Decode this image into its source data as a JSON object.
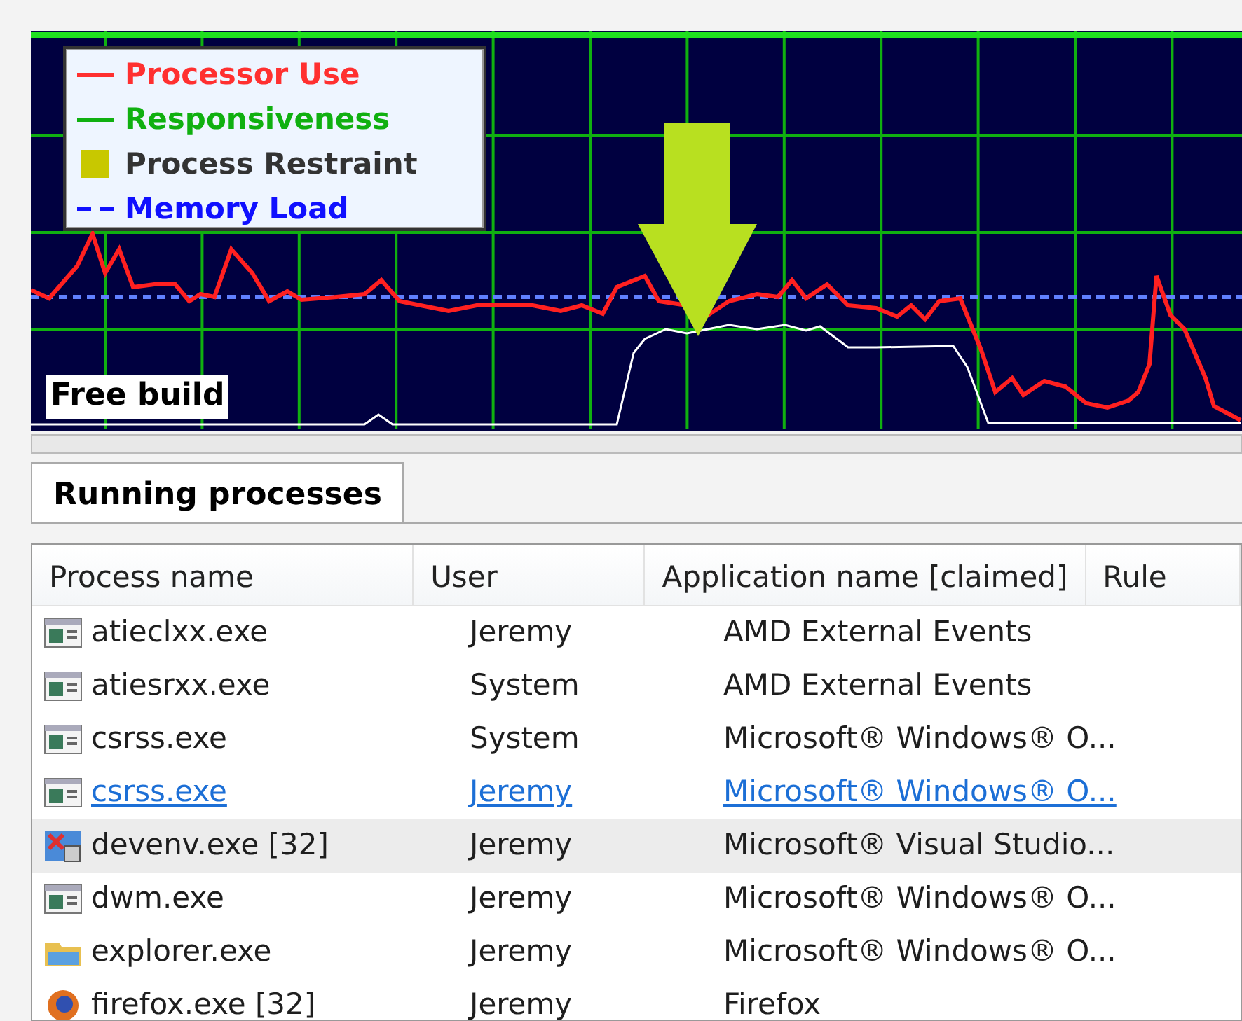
{
  "graph": {
    "legend": [
      {
        "label": "Processor Use",
        "kind": "line",
        "color": "#ff3030"
      },
      {
        "label": "Responsiveness",
        "kind": "line",
        "color": "#10b010"
      },
      {
        "label": "Process Restraint",
        "kind": "square",
        "color": "#c8c800"
      },
      {
        "label": "Memory Load",
        "kind": "dashed",
        "color": "#1010ff"
      }
    ],
    "build_label": "Free build"
  },
  "tabs": [
    {
      "label": "Running processes",
      "selected": true
    }
  ],
  "table": {
    "columns": [
      "Process name",
      "User",
      "Application name [claimed]",
      "Rule"
    ],
    "rows": [
      {
        "kind": "window",
        "cells": [
          "atieclxx.exe",
          "Jeremy",
          "AMD External Events"
        ],
        "hot": false,
        "selected": false
      },
      {
        "kind": "window",
        "cells": [
          "atiesrxx.exe",
          "System",
          "AMD External Events"
        ],
        "hot": false,
        "selected": false
      },
      {
        "kind": "window",
        "cells": [
          "csrss.exe",
          "System",
          "Microsoft® Windows® O..."
        ],
        "hot": false,
        "selected": false
      },
      {
        "kind": "window",
        "cells": [
          "csrss.exe",
          "Jeremy",
          "Microsoft® Windows® O..."
        ],
        "hot": true,
        "selected": false
      },
      {
        "kind": "studio",
        "cells": [
          "devenv.exe [32]",
          "Jeremy",
          "Microsoft® Visual Studio..."
        ],
        "hot": false,
        "selected": true
      },
      {
        "kind": "window",
        "cells": [
          "dwm.exe",
          "Jeremy",
          "Microsoft® Windows® O..."
        ],
        "hot": false,
        "selected": false
      },
      {
        "kind": "explorer",
        "cells": [
          "explorer.exe",
          "Jeremy",
          "Microsoft® Windows® O..."
        ],
        "hot": false,
        "selected": false
      },
      {
        "kind": "browser",
        "cells": [
          "firefox.exe [32]",
          "Jeremy",
          "Firefox"
        ],
        "hot": false,
        "selected": false
      }
    ]
  }
}
